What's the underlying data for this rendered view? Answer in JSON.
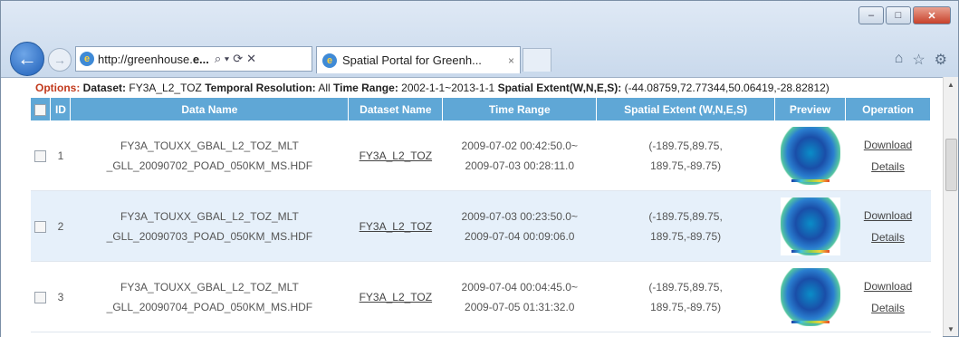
{
  "browser": {
    "url_prefix": "http://greenhouse.",
    "url_bold": "e...",
    "tab_title": "Spatial Portal for Greenh...",
    "tab_close": "×",
    "back_glyph": "←",
    "forward_glyph": "→",
    "search_glyph": "⌕ ▾",
    "refresh_glyph": "⟳",
    "stop_glyph": "✕",
    "home_glyph": "⌂",
    "star_glyph": "☆",
    "gear_glyph": "⚙",
    "win_min": "–",
    "win_max": "□",
    "win_close": "✕"
  },
  "options": {
    "label": "Options:",
    "dataset_label": "Dataset:",
    "dataset_value": "FY3A_L2_TOZ",
    "temporal_label": "Temporal Resolution:",
    "temporal_value": "All",
    "time_label": "Time Range:",
    "time_value": "2002-1-1~2013-1-1",
    "spatial_label": "Spatial Extent(W,N,E,S):",
    "spatial_value": "(-44.08759,72.77344,50.06419,-28.82812)"
  },
  "table": {
    "headers": {
      "id": "ID",
      "data_name": "Data Name",
      "dataset_name": "Dataset Name",
      "time_range": "Time Range",
      "spatial_extent": "Spatial Extent (W,N,E,S)",
      "preview": "Preview",
      "operation": "Operation"
    },
    "rows": [
      {
        "id": "1",
        "name_line1": "FY3A_TOUXX_GBAL_L2_TOZ_MLT",
        "name_line2": "_GLL_20090702_POAD_050KM_MS.HDF",
        "dataset": "FY3A_L2_TOZ",
        "time_line1": "2009-07-02 00:42:50.0~",
        "time_line2": "2009-07-03 00:28:11.0",
        "extent_line1": "(-189.75,89.75,",
        "extent_line2": "189.75,-89.75)",
        "download": "Download",
        "details": "Details"
      },
      {
        "id": "2",
        "name_line1": "FY3A_TOUXX_GBAL_L2_TOZ_MLT",
        "name_line2": "_GLL_20090703_POAD_050KM_MS.HDF",
        "dataset": "FY3A_L2_TOZ",
        "time_line1": "2009-07-03 00:23:50.0~",
        "time_line2": "2009-07-04 00:09:06.0",
        "extent_line1": "(-189.75,89.75,",
        "extent_line2": "189.75,-89.75)",
        "download": "Download",
        "details": "Details"
      },
      {
        "id": "3",
        "name_line1": "FY3A_TOUXX_GBAL_L2_TOZ_MLT",
        "name_line2": "_GLL_20090704_POAD_050KM_MS.HDF",
        "dataset": "FY3A_L2_TOZ",
        "time_line1": "2009-07-04 00:04:45.0~",
        "time_line2": "2009-07-05 01:31:32.0",
        "extent_line1": "(-189.75,89.75,",
        "extent_line2": "189.75,-89.75)",
        "download": "Download",
        "details": "Details"
      }
    ]
  }
}
